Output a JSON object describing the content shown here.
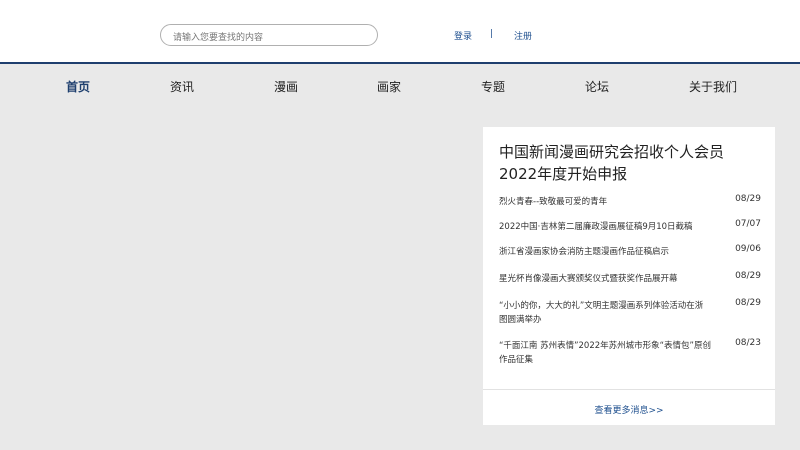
{
  "header": {
    "search_placeholder": "请输入您要查找的内容",
    "login_label": "登录",
    "separator": "|",
    "register_label": "注册"
  },
  "nav": {
    "items": [
      {
        "label": "首页",
        "active": true
      },
      {
        "label": "资讯"
      },
      {
        "label": "漫画"
      },
      {
        "label": "画家"
      },
      {
        "label": "专题"
      },
      {
        "label": "论坛"
      },
      {
        "label": "关于我们"
      }
    ]
  },
  "news_panel": {
    "title": "中国新闻漫画研究会招收个人会员2022年度开始申报",
    "items": [
      {
        "text": "烈火青春--致敬最可爱的青年",
        "date": "08/29"
      },
      {
        "text": "2022中国·吉林第二届廉政漫画展征稿9月10日截稿",
        "date": "07/07"
      },
      {
        "text": "浙江省漫画家协会消防主题漫画作品征稿启示",
        "date": "09/06"
      },
      {
        "text": "星光杯肖像漫画大赛颁奖仪式暨获奖作品展开幕",
        "date": "08/29"
      },
      {
        "text": "“小小的你，大大的礼”文明主题漫画系列体验活动在浙图圆满举办",
        "date": "08/29"
      },
      {
        "text": "“千面江南 苏州表情”2022年苏州城市形象“表情包”原创作品征集",
        "date": "08/23"
      }
    ],
    "more_label": "查看更多消息>>"
  }
}
